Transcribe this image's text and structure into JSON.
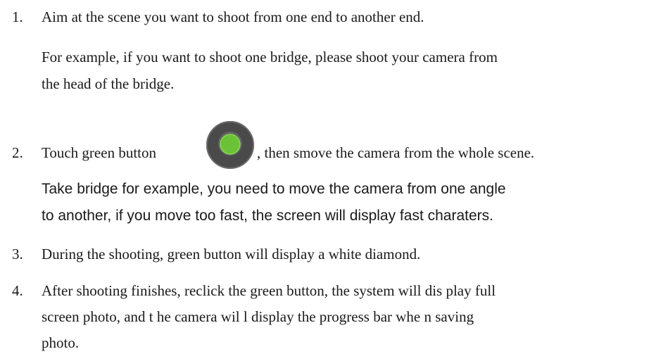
{
  "steps": [
    {
      "number": "1.",
      "text": "Aim at the scene you want to shoot from one end to another end.",
      "note_lines": [
        "For example, if you want to shoot one bridge, please shoot your camera from",
        "the head of the bridge."
      ]
    },
    {
      "number": "2.",
      "text_before": "Touch green button",
      "icon": "green-record-button-icon",
      "text_after": ", then smove the camera from the whole scene.",
      "note_lines": [
        "Take bridge for example, you need to move the camera from one angle",
        "to another, if you move too fast, the screen will display fast charaters."
      ]
    },
    {
      "number": "3.",
      "text": "During the shooting, green button will display a white diamond."
    },
    {
      "number": "4.",
      "lines": [
        "After shooting finishes, reclick the green button, the system will dis play full",
        "screen photo,  and t  he  camera wil l  display the   progress bar  whe n  saving",
        "photo."
      ]
    }
  ],
  "colors": {
    "button_outer": "#4a4a4a",
    "button_inner": "#6cc236"
  }
}
